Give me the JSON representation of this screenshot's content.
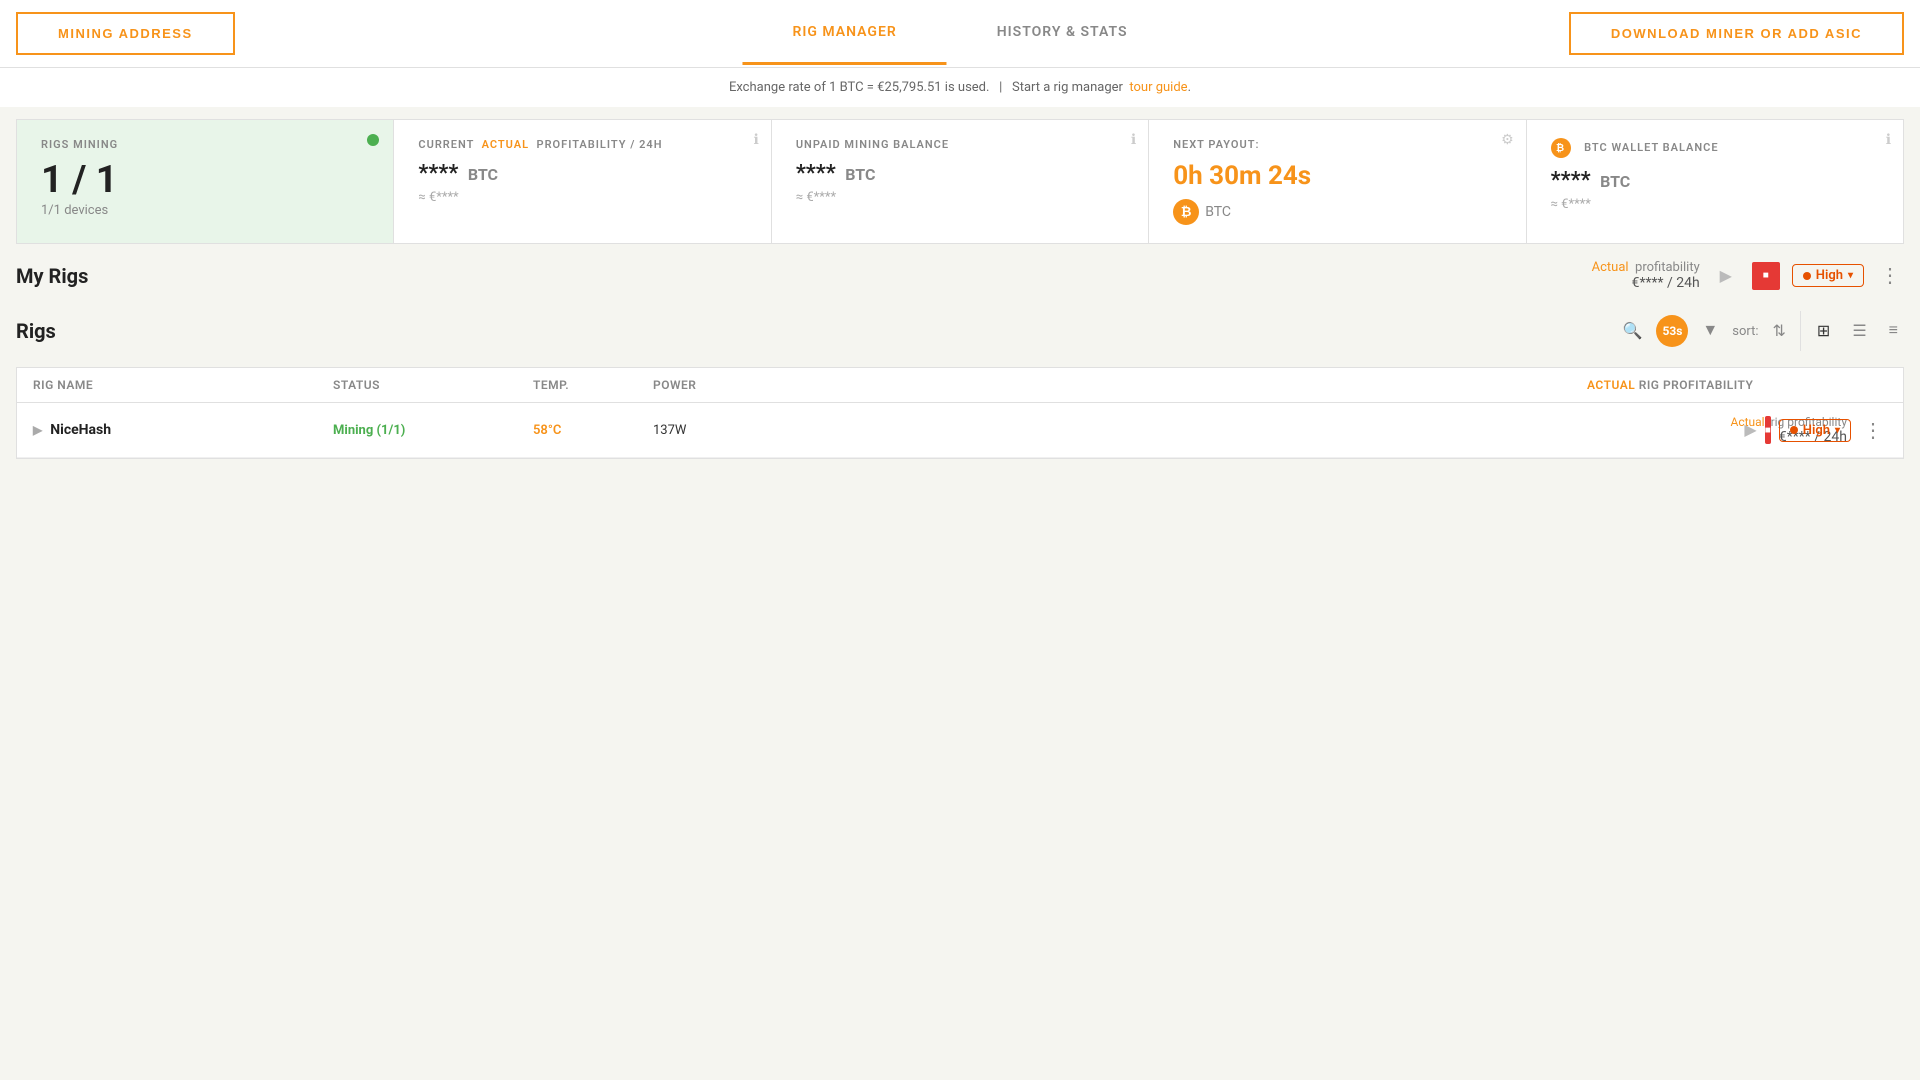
{
  "nav": {
    "mining_address_label": "MINING ADDRESS",
    "tab_rig_manager": "RIG MANAGER",
    "tab_history_stats": "HISTORY & STATS",
    "download_label": "DOWNLOAD MINER OR ADD ASIC",
    "active_tab": "rig_manager"
  },
  "exchange_bar": {
    "text": "Exchange rate of 1 BTC = €25,795.51 is used.",
    "separator": "|",
    "start_text": "Start a rig manager",
    "link_text": "tour guide",
    "link_end": "."
  },
  "stats": {
    "rigs_mining": {
      "label": "RIGS MINING",
      "count": "1 / 1",
      "devices": "1/1 devices"
    },
    "profitability": {
      "label_current": "CURRENT",
      "label_actual": "ACTUAL",
      "label_suffix": "PROFITABILITY / 24H",
      "value": "****",
      "currency": "BTC",
      "sub": "≈ €****"
    },
    "unpaid_balance": {
      "label": "UNPAID MINING BALANCE",
      "value": "****",
      "currency": "BTC",
      "sub": "≈ €****"
    },
    "next_payout": {
      "label": "NEXT PAYOUT:",
      "countdown": "0h 30m 24s",
      "currency": "BTC"
    },
    "btc_wallet": {
      "label": "BTC WALLET BALANCE",
      "value": "****",
      "currency": "BTC",
      "sub": "≈ €****"
    }
  },
  "my_rigs": {
    "title": "My Rigs",
    "profitability_label_actual": "Actual",
    "profitability_label_rest": "profitability",
    "profitability_value": "€**** / 24h",
    "high_label": "High",
    "play_icon": "▶",
    "stop_icon": "■",
    "more_icon": "⋮"
  },
  "rigs": {
    "title": "Rigs",
    "timer": "53s",
    "sort_label": "sort:",
    "search_icon": "🔍",
    "filter_icon": "▼",
    "sort_icon": "⇅",
    "view_grid_icon": "⊞",
    "view_list_icon": "☰",
    "view_compact_icon": "≡",
    "table": {
      "headers": [
        "Rig name",
        "Status",
        "Temp.",
        "Power",
        "",
        "Actual rig profitability",
        ""
      ],
      "rows": [
        {
          "name": "NiceHash",
          "status": "Mining (1/1)",
          "temp": "58°C",
          "power": "137W",
          "profitability_label_actual": "Actual",
          "profitability_label_rest": "rig profitability",
          "profitability_value": "€**** / 24h",
          "high_label": "High"
        }
      ]
    }
  },
  "colors": {
    "orange": "#f7931a",
    "green": "#4caf50",
    "red": "#e53935",
    "orange_dark": "#e65100",
    "light_green_bg": "#e8f5e9"
  }
}
